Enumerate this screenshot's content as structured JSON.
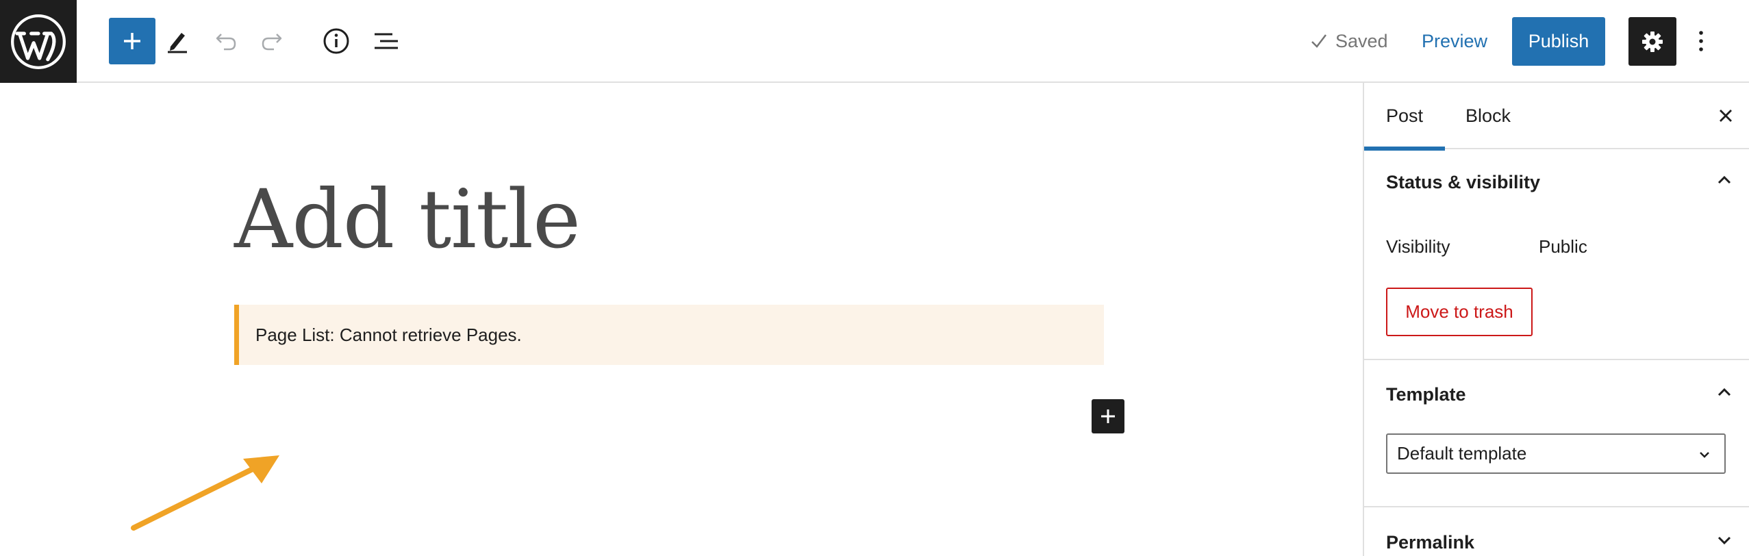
{
  "toolbar": {
    "logo": "wordpress-logo",
    "icons": [
      "plus-icon",
      "pencil-icon",
      "undo-icon",
      "redo-icon",
      "info-icon",
      "list-view-icon"
    ],
    "saved_label": "Saved",
    "preview_label": "Preview",
    "publish_label": "Publish",
    "accent_color": "#2271b1"
  },
  "editor": {
    "title_placeholder": "Add title",
    "notice_text": "Page List: Cannot retrieve Pages.",
    "notice_border_color": "#f0a326",
    "notice_bg_color": "#fcf3e8"
  },
  "sidebar": {
    "tabs": [
      {
        "label": "Post",
        "active": true
      },
      {
        "label": "Block",
        "active": false
      }
    ],
    "status_visibility": {
      "title": "Status & visibility",
      "visibility_label": "Visibility",
      "visibility_value": "Public",
      "trash_label": "Move to trash"
    },
    "template": {
      "title": "Template",
      "selected": "Default template"
    },
    "permalink": {
      "title": "Permalink"
    }
  }
}
